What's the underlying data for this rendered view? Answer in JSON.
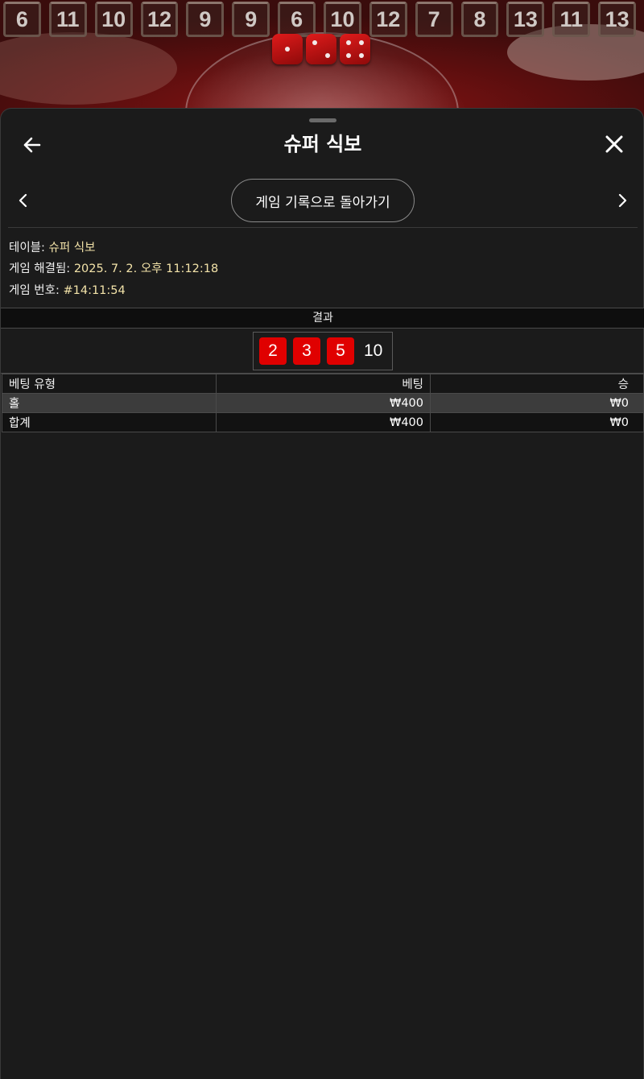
{
  "history": [
    "6",
    "11",
    "10",
    "12",
    "9",
    "9",
    "6",
    "10",
    "12",
    "7",
    "8",
    "13",
    "11",
    "13"
  ],
  "scene_dice": [
    1,
    2,
    4
  ],
  "header": {
    "title": "슈퍼 식보"
  },
  "nav": {
    "back_to_history": "게임 기록으로 돌아가기"
  },
  "meta": {
    "table_label": "테이블: ",
    "table_value": "슈퍼 식보",
    "resolved_label": "게임 해결됨: ",
    "resolved_value": "2025. 7. 2. 오후 11:12:18",
    "game_no_label": "게임 번호: ",
    "game_no_value": "#14:11:54"
  },
  "result": {
    "heading": "결과",
    "dice": [
      "2",
      "3",
      "5"
    ],
    "total": "10"
  },
  "bets_table": {
    "headers": [
      "베팅 유형",
      "베팅",
      "승"
    ],
    "rows": [
      [
        "홀",
        "₩400",
        "₩0"
      ],
      [
        "합계",
        "₩400",
        "₩0"
      ]
    ]
  },
  "colors": {
    "accent_value": "#f3e3a9",
    "dice_red": "#e00000",
    "background": "#1b1b1b"
  }
}
